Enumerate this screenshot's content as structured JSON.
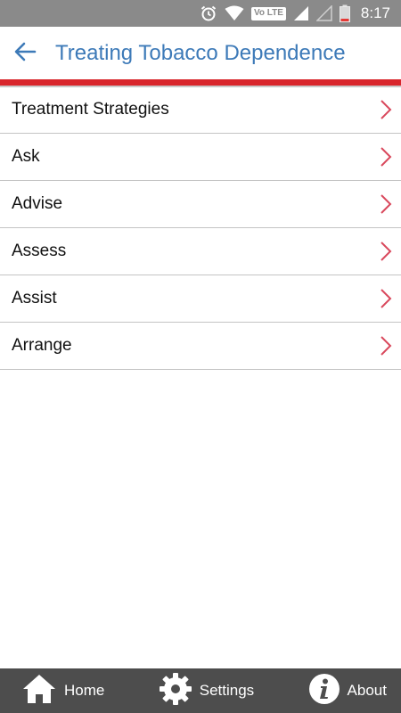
{
  "status_bar": {
    "time": "8:17",
    "volte_label": "Vo LTE",
    "icons": [
      "alarm-icon",
      "wifi-icon",
      "volte-icon",
      "signal-icon",
      "signal-empty-icon",
      "battery-low-icon"
    ]
  },
  "app_bar": {
    "title": "Treating Tobacco Dependence",
    "back_icon": "arrow-left-icon"
  },
  "colors": {
    "title": "#3d7ab8",
    "accent": "#d8262c",
    "chevron": "#d9485c",
    "nav_background": "#4d4d4d",
    "status_background": "#8a8a8a"
  },
  "menu": {
    "items": [
      {
        "label": "Treatment Strategies"
      },
      {
        "label": "Ask"
      },
      {
        "label": "Advise"
      },
      {
        "label": "Assess"
      },
      {
        "label": "Assist"
      },
      {
        "label": "Arrange"
      }
    ]
  },
  "bottom_nav": {
    "home_label": "Home",
    "settings_label": "Settings",
    "about_label": "About"
  }
}
